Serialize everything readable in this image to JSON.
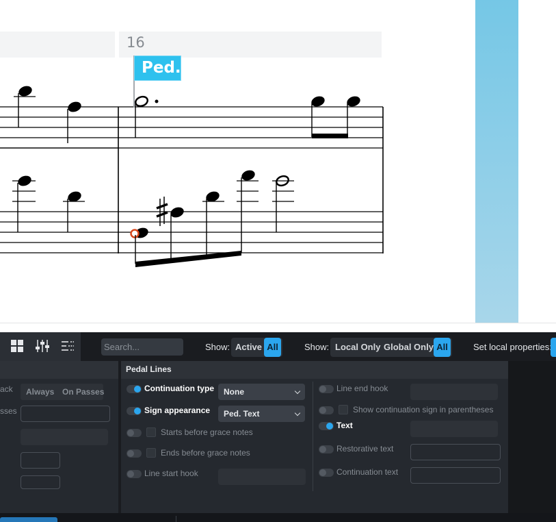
{
  "score": {
    "bar_number": "16",
    "pedal_label": "Ped."
  },
  "toolbar": {
    "search_placeholder": "Search...",
    "show1_label": "Show:",
    "show1_options": [
      "Active",
      "All"
    ],
    "show2_label": "Show:",
    "show2_options": [
      "Local Only",
      "Global Only",
      "All"
    ],
    "set_local_label": "Set local properties:",
    "selected_show1": "All",
    "selected_show2": "All"
  },
  "left_section": {
    "row1_label": "ack",
    "row2_label": "sses",
    "playback_options": [
      "Always",
      "On Passes"
    ]
  },
  "pedal_lines": {
    "title": "Pedal Lines",
    "left_column": [
      {
        "label": "Continuation type",
        "active": true,
        "value": "None"
      },
      {
        "label": "Sign appearance",
        "active": true,
        "value": "Ped. Text"
      },
      {
        "label": "Starts before grace notes",
        "active": false
      },
      {
        "label": "Ends before grace notes",
        "active": false
      },
      {
        "label": "Line start hook",
        "active": false
      }
    ],
    "right_column": [
      {
        "label": "Line end hook",
        "active": false
      },
      {
        "label": "Show continuation sign in parentheses",
        "active": false
      },
      {
        "label": "Text",
        "active": true
      },
      {
        "label": "Restorative text",
        "active": false
      },
      {
        "label": "Continuation text",
        "active": false
      }
    ]
  },
  "colors": {
    "accent": "#2ba6ee",
    "pedal_flag": "#2ec1ee",
    "panel_bg": "#25292f",
    "selected_note": "#d9481c"
  },
  "icons": [
    "grid-view-icon",
    "mixer-sliders-icon",
    "list-filter-icon",
    "chevron-down-icon"
  ]
}
